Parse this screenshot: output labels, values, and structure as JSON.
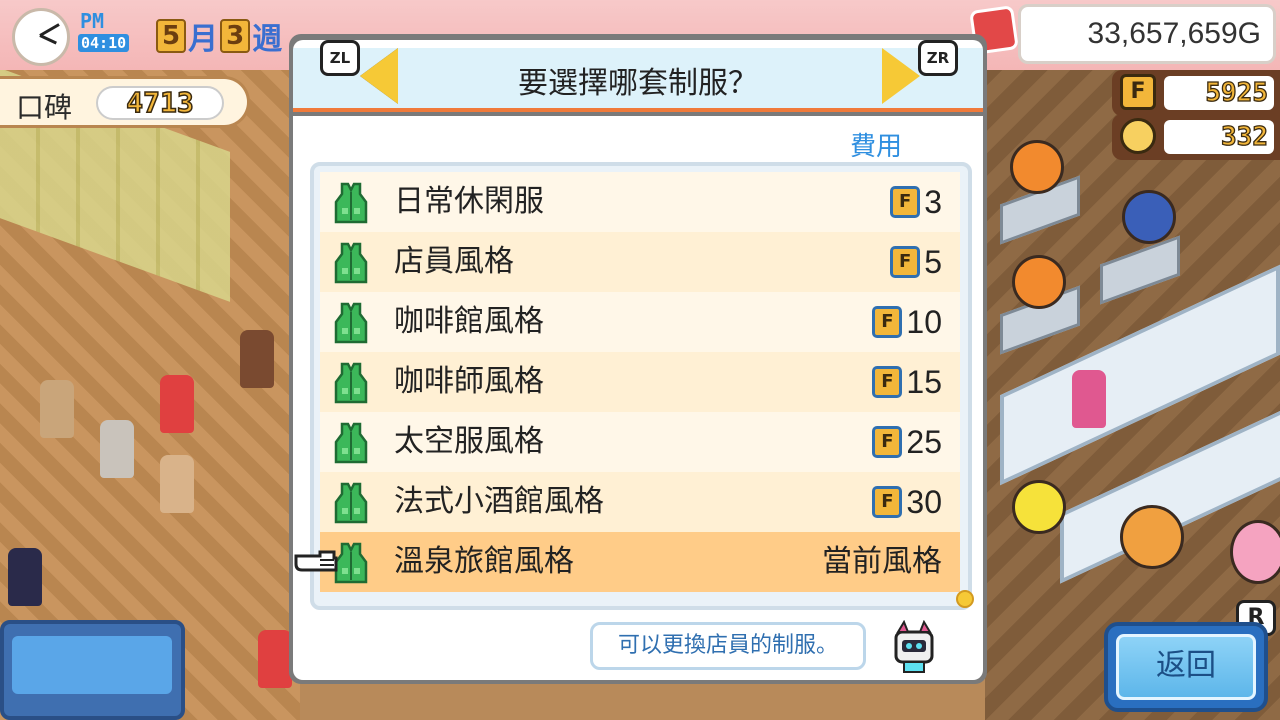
{
  "hud": {
    "ampm": "PM",
    "time": "04:10",
    "month": "5",
    "month_label": "月",
    "week": "3",
    "week_label": "週",
    "money": "33,657,659G",
    "reputation_label": "口碑",
    "reputation_value": "4713",
    "points_icon": "F",
    "points_value": "5925",
    "coins_value": "332"
  },
  "dialog": {
    "title": "要選擇哪套制服？",
    "left_button": "ZL",
    "right_button": "ZR",
    "cost_header": "費用",
    "cost_icon": "F",
    "items": [
      {
        "label": "日常休閑服",
        "cost": "3",
        "selected": false
      },
      {
        "label": "店員風格",
        "cost": "5",
        "selected": false
      },
      {
        "label": "咖啡館風格",
        "cost": "10",
        "selected": false
      },
      {
        "label": "咖啡師風格",
        "cost": "15",
        "selected": false
      },
      {
        "label": "太空服風格",
        "cost": "25",
        "selected": false
      },
      {
        "label": "法式小酒館風格",
        "cost": "30",
        "selected": false
      },
      {
        "label": "溫泉旅館風格",
        "cost": "當前風格",
        "selected": true
      }
    ],
    "hint": "可以更換店員的制服。"
  },
  "back_button": {
    "label": "返回",
    "shortcut": "R"
  },
  "colors": {
    "dialog_header_bg": "#ddf2fa",
    "accent_orange": "#f07a3a",
    "selected_row": "#ffcc88",
    "cost_blue": "#2f8fe0",
    "uniform_green": "#3cb85a",
    "back_button": "#5db6ea"
  }
}
